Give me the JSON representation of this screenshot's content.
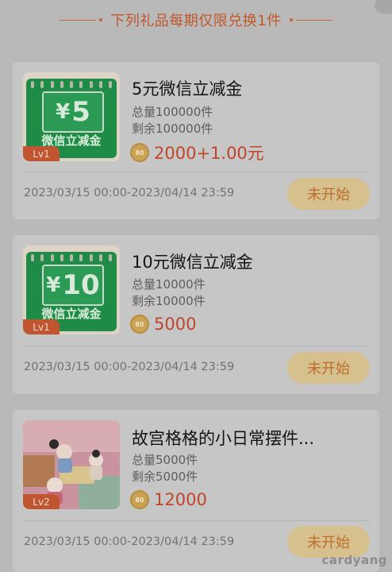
{
  "header": {
    "title": "下列礼品每期仅限兑换1件"
  },
  "coin_icon_text": "80",
  "items": [
    {
      "title": "5元微信立减金",
      "total": "总量100000件",
      "remaining": "剩余100000件",
      "price": "2000+1.00元",
      "date_range": "2023/03/15 00:00-2023/04/14 23:59",
      "status": "未开始",
      "level": "Lv1",
      "ticket": {
        "yen": "¥",
        "amount": "5",
        "caption": "微信立减金"
      }
    },
    {
      "title": "10元微信立减金",
      "total": "总量10000件",
      "remaining": "剩余10000件",
      "price": "5000",
      "date_range": "2023/03/15 00:00-2023/04/14 23:59",
      "status": "未开始",
      "level": "Lv1",
      "ticket": {
        "yen": "¥",
        "amount": "10",
        "caption": "微信立减金"
      }
    },
    {
      "title": "故宫格格的小日常摆件...",
      "total": "总量5000件",
      "remaining": "剩余5000件",
      "price": "12000",
      "date_range": "2023/03/15 00:00-2023/04/14 23:59",
      "status": "未开始",
      "level": "Lv2"
    }
  ],
  "watermark": "cardyang",
  "colors": {
    "accent": "#c0452a",
    "button_bg": "#d6c08e",
    "button_text": "#bf6d2d",
    "ticket_green": "#1e8c46"
  }
}
